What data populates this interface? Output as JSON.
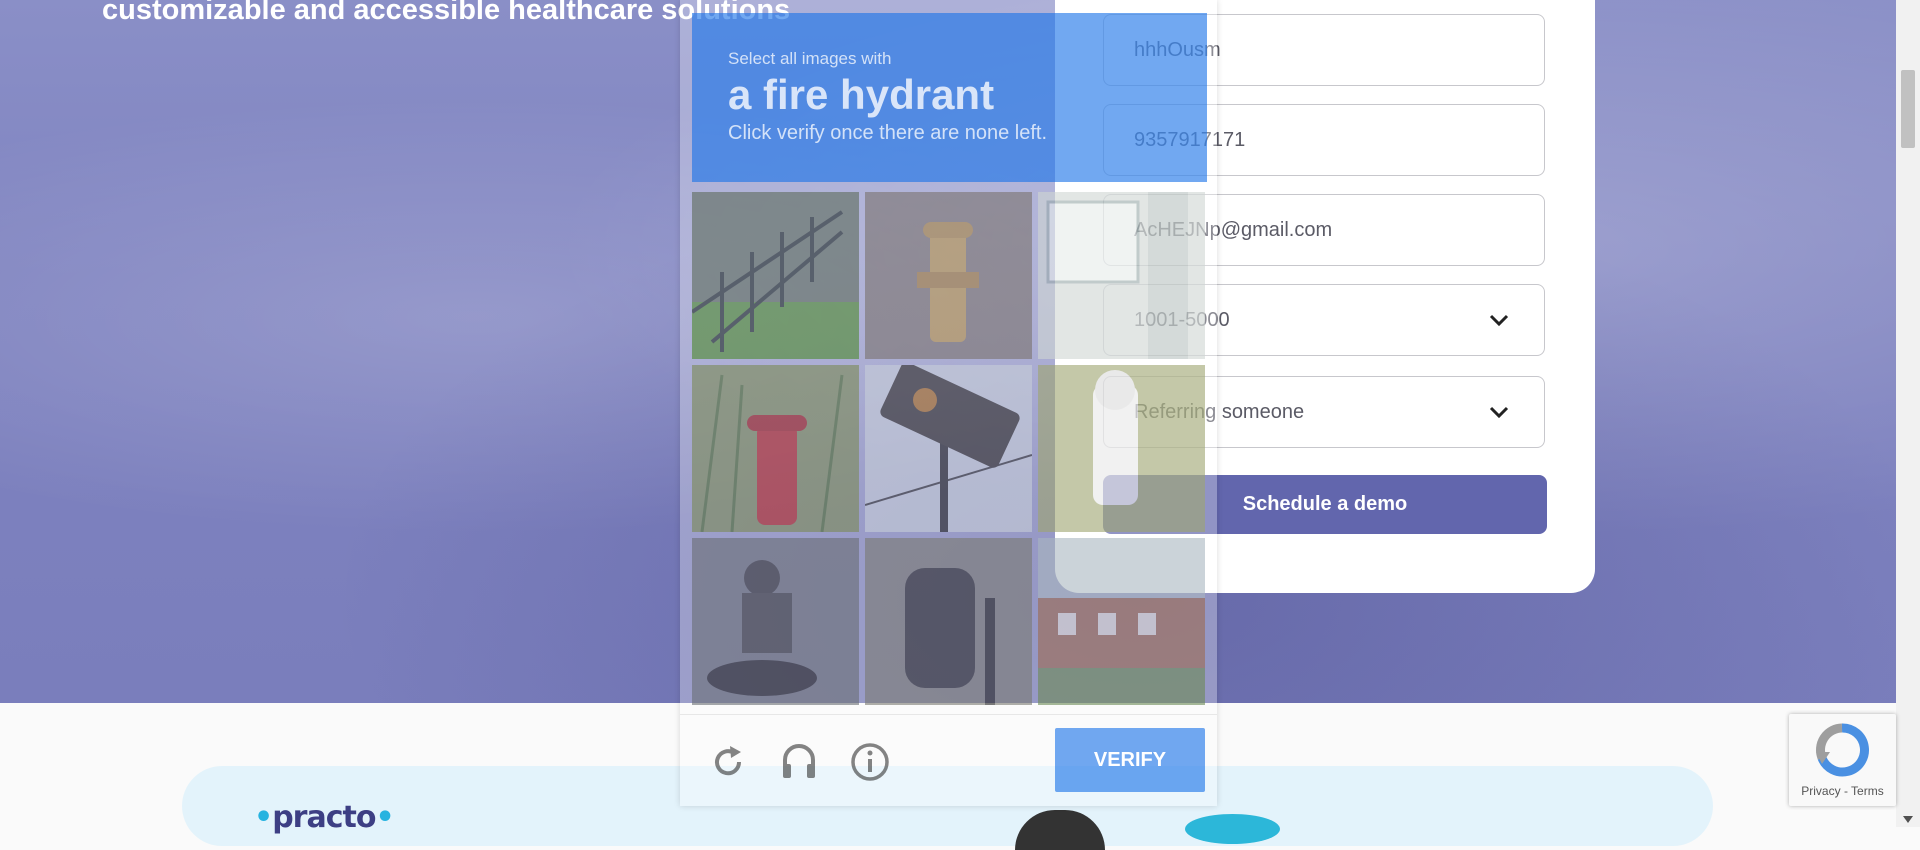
{
  "hero": {
    "subtitle": "customizable and accessible healthcare solutions"
  },
  "form": {
    "name_value": "hhhOusm",
    "phone_value": "9357917171",
    "email_value": "AcHEJNp@gmail.com",
    "company_size_value": "1001-5000",
    "interest_value": "Referring someone",
    "submit_label": "Schedule a demo",
    "accent_color": "#6266ad"
  },
  "captcha": {
    "instruction": "Select all images with",
    "target": "a fire hydrant",
    "hint": "Click verify once there are none left.",
    "verify_label": "VERIFY",
    "tiles": [
      {
        "content": "stairs-railing"
      },
      {
        "content": "fire-hydrant"
      },
      {
        "content": "building-window"
      },
      {
        "content": "fire-hydrant"
      },
      {
        "content": "traffic-light"
      },
      {
        "content": "fire-hydrant"
      },
      {
        "content": "motorcycle-riders"
      },
      {
        "content": "parked-scooter"
      },
      {
        "content": "building-street"
      }
    ],
    "icons": [
      "reload-icon",
      "audio-icon",
      "info-icon"
    ],
    "accent_color": "#1a73e8"
  },
  "brand": {
    "logo_text": "practo"
  },
  "recaptcha_badge": {
    "links": "Privacy - Terms"
  }
}
